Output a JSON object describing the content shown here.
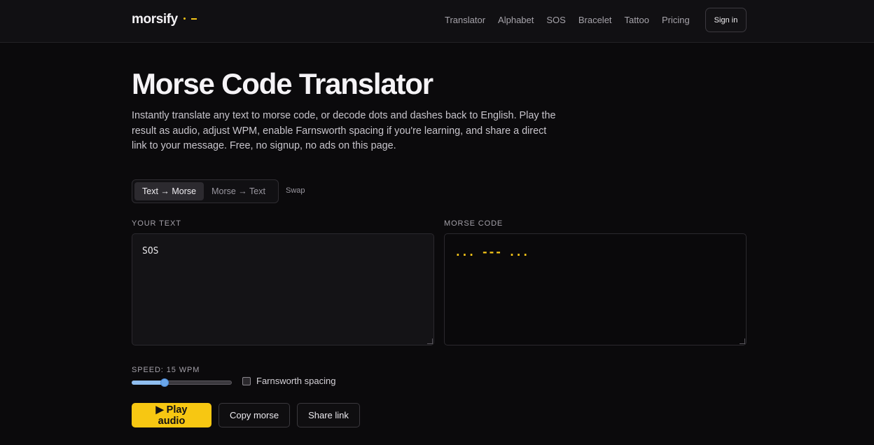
{
  "brand": {
    "name": "morsify",
    "accent_color": "#f5c518"
  },
  "nav": {
    "items": [
      "Translator",
      "Alphabet",
      "SOS",
      "Bracelet",
      "Tattoo",
      "Pricing"
    ],
    "signin_label": "Sign in"
  },
  "hero": {
    "title": "Morse Code Translator",
    "intro": "Instantly translate any text to morse code, or decode dots and dashes back to English. Play the result as audio, adjust WPM, enable Farnsworth spacing if you're learning, and share a direct link to your message. Free, no signup, no ads on this page."
  },
  "mode": {
    "options": [
      "Text → Morse",
      "Morse → Text"
    ],
    "active": "Text → Morse",
    "swap_label": "Swap"
  },
  "input": {
    "label": "YOUR TEXT",
    "value": "SOS"
  },
  "output": {
    "label": "MORSE CODE",
    "value": "... --- ..."
  },
  "controls": {
    "speed_label": "SPEED: 15 WPM",
    "speed_fraction": 0.31,
    "farnsworth_label": "Farnsworth spacing",
    "farnsworth_checked": false
  },
  "actions": {
    "play_label": "▶ Play audio",
    "copy_label": "Copy morse",
    "share_label": "Share link"
  }
}
